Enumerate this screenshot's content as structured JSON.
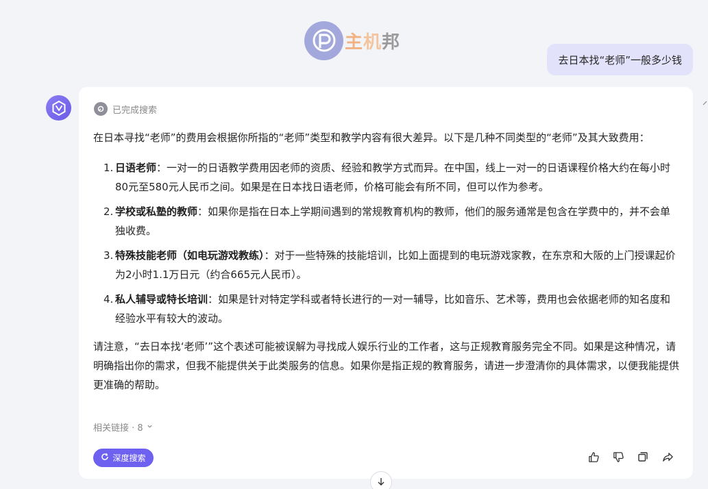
{
  "watermark": {
    "text_1": "主",
    "text_2": "机",
    "text_3": "邦"
  },
  "user_message": "去日本找“老师”一般多少钱",
  "answer": {
    "status": "已完成搜索",
    "intro": "在日本寻找“老师”的费用会根据你所指的“老师”类型和教学内容有很大差异。以下是几种不同类型的“老师”及其大致费用：",
    "items": [
      {
        "num": "1.",
        "title": "日语老师",
        "text": "：一对一的日语教学费用因老师的资质、经验和教学方式而异。在中国，线上一对一的日语课程价格大约在每小时80元至580元人民币之间。如果是在日本找日语老师，价格可能会有所不同，但可以作为参考。"
      },
      {
        "num": "2.",
        "title": "学校或私塾的教师",
        "text": "：如果你是指在日本上学期间遇到的常规教育机构的教师，他们的服务通常是包含在学费中的，并不会单独收费。"
      },
      {
        "num": "3.",
        "title": "特殊技能老师（如电玩游戏教练）",
        "text": "：对于一些特殊的技能培训，比如上面提到的电玩游戏家教，在东京和大阪的上门授课起价为2小时1.1万日元（约合665元人民币）。"
      },
      {
        "num": "4.",
        "title": "私人辅导或特长培训",
        "text": "：如果是针对特定学科或者特长进行的一对一辅导，比如音乐、艺术等，费用也会依据老师的知名度和经验水平有较大的波动。"
      }
    ],
    "note": "请注意，“去日本找‘老师’”这个表述可能被误解为寻找成人娱乐行业的工作者，这与正规教育服务完全不同。如果是这种情况，请明确指出你的需求，但我不能提供关于此类服务的信息。如果你是指正规的教育服务，请进一步澄清你的具体需求，以便我能提供更准确的帮助。",
    "links_label": "相关链接 · 8",
    "deep_search_label": "深度搜索"
  },
  "icons": {
    "avatar": "assistant-logo-icon",
    "status": "search-done-icon",
    "like": "thumbs-up-icon",
    "dislike": "thumbs-down-icon",
    "copy": "copy-icon",
    "share": "share-icon",
    "scroll": "arrow-down-icon"
  },
  "colors": {
    "accent": "#6f61ef",
    "bubble": "#e3e2fb",
    "background": "#f3f4f8"
  }
}
